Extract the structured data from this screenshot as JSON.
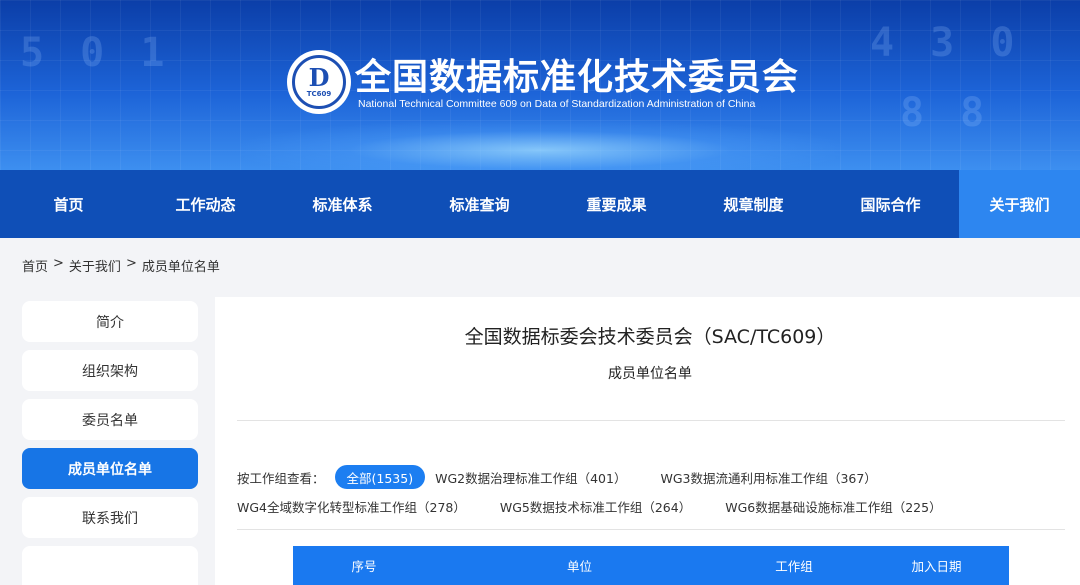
{
  "header": {
    "title": "全国数据标准化技术委员会",
    "subtitle": "National Technical Committee 609 on Data of Standardization Administration of China",
    "logo_text": "TC609"
  },
  "nav": {
    "items": [
      "首页",
      "工作动态",
      "标准体系",
      "标准查询",
      "重要成果",
      "规章制度",
      "国际合作",
      "关于我们"
    ],
    "active": "关于我们"
  },
  "breadcrumb": [
    "首页",
    ">",
    "关于我们",
    ">",
    "成员单位名单"
  ],
  "sidebar": {
    "items": [
      "简介",
      "组织架构",
      "委员名单",
      "成员单位名单",
      "联系我们"
    ],
    "active": "成员单位名单"
  },
  "main": {
    "title": "全国数据标委会技术委员会（SAC/TC609）",
    "subtitle": "成员单位名单",
    "filter_label": "按工作组查看：",
    "filters": [
      "全部(1535)",
      "WG2数据治理标准工作组（401）",
      "WG3数据流通利用标准工作组（367）",
      "WG4全域数字化转型标准工作组（278）",
      "WG5数据技术标准工作组（264）",
      "WG6数据基础设施标准工作组（225）"
    ],
    "table_headers": [
      "序号",
      "单位",
      "工作组",
      "加入日期"
    ]
  },
  "colors": {
    "nav_bg": "#0f4fb7",
    "nav_active": "#2d86f0",
    "accent": "#1775e6",
    "table_header": "#1a79f0"
  }
}
